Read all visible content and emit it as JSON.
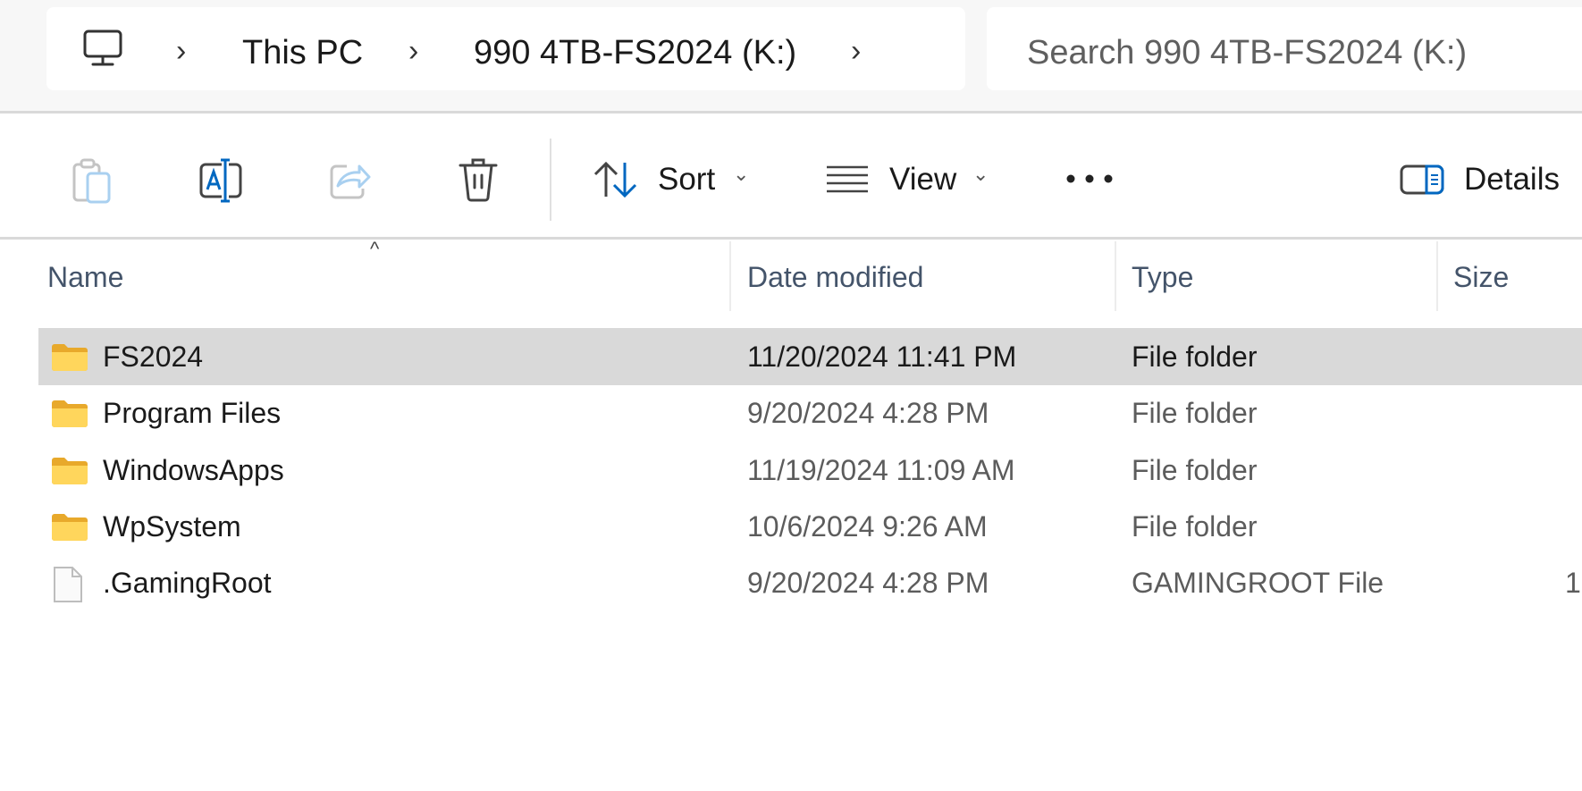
{
  "breadcrumb": {
    "items": [
      "This PC",
      "990 4TB-FS2024 (K:)"
    ]
  },
  "search": {
    "placeholder": "Search 990 4TB-FS2024 (K:)"
  },
  "toolbar": {
    "sort_label": "Sort",
    "view_label": "View",
    "details_label": "Details",
    "accent": "#0067c0"
  },
  "columns": {
    "name": "Name",
    "date": "Date modified",
    "type": "Type",
    "size": "Size"
  },
  "files": [
    {
      "name": "FS2024",
      "date": "11/20/2024 11:41 PM",
      "type": "File folder",
      "size": "",
      "icon": "folder-icon",
      "selected": true
    },
    {
      "name": "Program Files",
      "date": "9/20/2024 4:28 PM",
      "type": "File folder",
      "size": "",
      "icon": "folder-icon"
    },
    {
      "name": "WindowsApps",
      "date": "11/19/2024 11:09 AM",
      "type": "File folder",
      "size": "",
      "icon": "folder-icon"
    },
    {
      "name": "WpSystem",
      "date": "10/6/2024 9:26 AM",
      "type": "File folder",
      "size": "",
      "icon": "folder-icon"
    },
    {
      "name": ".GamingRoot",
      "date": "9/20/2024 4:28 PM",
      "type": "GAMINGROOT File",
      "size": "1",
      "icon": "file-icon"
    }
  ]
}
